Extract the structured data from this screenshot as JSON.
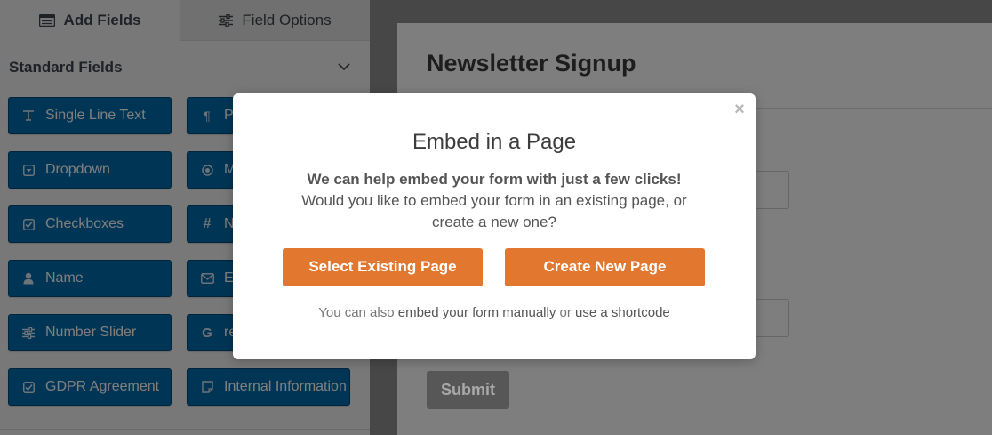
{
  "tabs": {
    "add_fields": "Add Fields",
    "field_options": "Field Options"
  },
  "section": {
    "title": "Standard Fields"
  },
  "fields": [
    {
      "label": "Single Line Text",
      "icon": "text-icon",
      "glyph": "T"
    },
    {
      "label": "Pa",
      "icon": "paragraph-icon",
      "glyph": "¶"
    },
    {
      "label": "Dropdown",
      "icon": "dropdown-icon",
      "glyph": "▾"
    },
    {
      "label": "M",
      "icon": "radio-icon",
      "glyph": "◉"
    },
    {
      "label": "Checkboxes",
      "icon": "checkbox-icon",
      "glyph": "☑"
    },
    {
      "label": "N",
      "icon": "number-icon",
      "glyph": "#"
    },
    {
      "label": "Name",
      "icon": "user-icon",
      "glyph": "👤"
    },
    {
      "label": "E",
      "icon": "email-icon",
      "glyph": "✉"
    },
    {
      "label": "Number Slider",
      "icon": "slider-icon",
      "glyph": "⚌"
    },
    {
      "label": "re",
      "icon": "google-icon",
      "glyph": "G"
    },
    {
      "label": "GDPR Agreement",
      "icon": "gdpr-checkbox-icon",
      "glyph": "☑"
    },
    {
      "label": "Internal Information",
      "icon": "note-icon",
      "glyph": "▢"
    }
  ],
  "form": {
    "title": "Newsletter Signup",
    "submit_label": "Submit"
  },
  "modal": {
    "title": "Embed in a Page",
    "desc_bold": "We can help embed your form with just a few clicks!",
    "desc_line2": "Would you like to embed your form in an existing page, or",
    "desc_line3": "create a new one?",
    "select_existing_label": "Select Existing Page",
    "create_new_label": "Create New Page",
    "footer_prefix": "You can also",
    "footer_link1": "embed your form manually",
    "footer_middle": "or",
    "footer_link2": "use a shortcode",
    "close_glyph": "×"
  },
  "colors": {
    "field_button": "#036aab",
    "modal_button": "#e27730"
  }
}
